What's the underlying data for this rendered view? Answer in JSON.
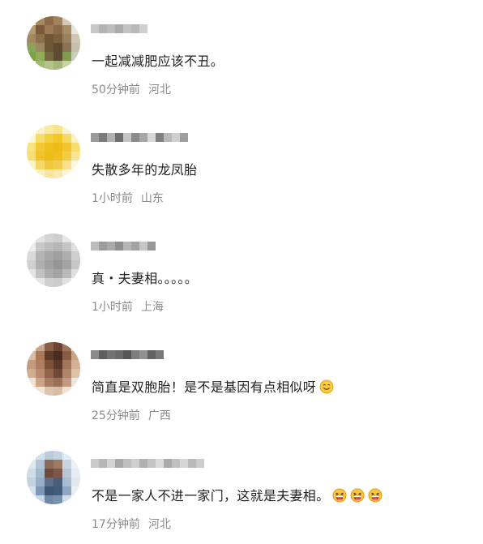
{
  "comments": [
    {
      "text": "一起减减肥应该不丑。",
      "time": "50分钟前",
      "location": "河北",
      "emoji_icon": "",
      "emoji_count": 0,
      "avatar_colors": [
        "#eef0ec",
        "#a4885e",
        "#8d6a45",
        "#a0825c",
        "#d6c9b1",
        "#f3f3f1",
        "#b69a72",
        "#7a5a3a",
        "#9b7b55",
        "#8a6a46",
        "#a78b66",
        "#e9e5dc",
        "#a0885f",
        "#8e6f4d",
        "#6f5436",
        "#7c5f3d",
        "#9a805c",
        "#d2c7b2",
        "#8aa35a",
        "#9a8a5d",
        "#6b5638",
        "#5e4a31",
        "#8a7352",
        "#c6bea9",
        "#7ea346",
        "#93ad58",
        "#76683f",
        "#5c4c32",
        "#819a4e",
        "#c9cfb8",
        "#e8ece1",
        "#9fbb6d",
        "#b2c487",
        "#a4b77a",
        "#c5d2a6",
        "#f1f3ec"
      ],
      "username_colors": [
        "#c7c7c7",
        "#b3b3b3",
        "#bdbdbd",
        "#aaaaaa",
        "#c2c2c2",
        "#b8b8b8",
        "#d0d0d0"
      ]
    },
    {
      "text": "失散多年的龙凤胎",
      "time": "1小时前",
      "location": "山东",
      "emoji_icon": "",
      "emoji_count": 0,
      "avatar_colors": [
        "#ffffff",
        "#fbf3c7",
        "#f9eaa0",
        "#f7e48a",
        "#fcf4cf",
        "#ffffff",
        "#fdf7dd",
        "#f6dd6b",
        "#f2cf3c",
        "#f1c72a",
        "#f5d964",
        "#fbf1c0",
        "#f7e27d",
        "#f1c733",
        "#efbf1c",
        "#eebc16",
        "#f1c430",
        "#f6dc6d",
        "#f6dd74",
        "#f0c22a",
        "#eebd1b",
        "#efbf22",
        "#f3cc45",
        "#f9e59a",
        "#fcf2c7",
        "#f5d86a",
        "#f1c741",
        "#f3cd52",
        "#f8e08d",
        "#fdf6dc",
        "#ffffff",
        "#fcf0c4",
        "#f9e5a3",
        "#fae9b0",
        "#fdf6dc",
        "#ffffff"
      ],
      "username_colors": [
        "#9a9a9a",
        "#7a7a7a",
        "#b0b0b0",
        "#6e6e6e",
        "#c4c4c4",
        "#8a8a8a",
        "#a6a6a6",
        "#d8d8d8",
        "#7f7f7f",
        "#b8b8b8",
        "#cfcfcf",
        "#9e9e9e"
      ]
    },
    {
      "text": "真・夫妻相。。。。。",
      "time": "1小时前",
      "location": "上海",
      "emoji_icon": "",
      "emoji_count": 0,
      "avatar_colors": [
        "#ffffff",
        "#e3e3e3",
        "#d4d4d4",
        "#cfcfcf",
        "#e6e6e6",
        "#ffffff",
        "#ececec",
        "#c8c8c8",
        "#bdbdbd",
        "#b5b5b5",
        "#c4c4c4",
        "#e0e0e0",
        "#d9d9d9",
        "#b3b3b3",
        "#a7a7a7",
        "#9e9e9e",
        "#adadad",
        "#cdcdcd",
        "#d0d0d0",
        "#b0b0b0",
        "#a1a1a1",
        "#959595",
        "#a4a4a4",
        "#c6c6c6",
        "#e4e4e4",
        "#c1c1c1",
        "#acacac",
        "#a3a3a3",
        "#b9b9b9",
        "#dedede",
        "#ffffff",
        "#e6e6e6",
        "#cfcfcf",
        "#cbcbcb",
        "#e0e0e0",
        "#ffffff"
      ],
      "username_colors": [
        "#bdbdbd",
        "#9c9c9c",
        "#aaaaaa",
        "#8f8f8f",
        "#b4b4b4",
        "#a3a3a3",
        "#c6c6c6",
        "#989898"
      ]
    },
    {
      "text": "简直是双胞胎！是不是基因有点相似呀",
      "time": "25分钟前",
      "location": "广西",
      "emoji_icon": "smile-emoji-icon",
      "emoji_count": 1,
      "avatar_colors": [
        "#f4ece4",
        "#c7a48a",
        "#8a5f45",
        "#6a4432",
        "#9f7559",
        "#e8dbcf",
        "#d9bea6",
        "#a9795a",
        "#5e3b2a",
        "#4a2c1f",
        "#8a5c42",
        "#c9a488",
        "#c59a7c",
        "#b07d5e",
        "#7d5039",
        "#5a3726",
        "#a3735a",
        "#d3b096",
        "#d0ac90",
        "#b98a6b",
        "#8f644a",
        "#714836",
        "#b08467",
        "#deC2a8",
        "#efe2d7",
        "#caa588",
        "#a67d61",
        "#9a7057",
        "#c29b7f",
        "#f2e6dc",
        "#ffffff",
        "#f0e4d9",
        "#dcc3ae",
        "#d7bca6",
        "#eee1d6",
        "#ffffff"
      ],
      "username_colors": [
        "#8a8a8a",
        "#5f5f5f",
        "#737373",
        "#6a6a6a",
        "#555555",
        "#7d7d7d",
        "#919191",
        "#636363",
        "#787878"
      ]
    },
    {
      "text": "不是一家人不进一家门，这就是夫妻相。",
      "time": "17分钟前",
      "location": "河北",
      "emoji_icon": "laughing-emoji-icon",
      "emoji_count": 3,
      "avatar_colors": [
        "#f3f6f9",
        "#d6e0ea",
        "#bccbdb",
        "#c6d3e1",
        "#e4eaf1",
        "#fafbfd",
        "#dfe7ef",
        "#b3c4d6",
        "#8a6a58",
        "#9c7a66",
        "#c8d5e2",
        "#eef2f6",
        "#cfdbe6",
        "#a5b9cd",
        "#6e4d3e",
        "#7c5848",
        "#b5c6d7",
        "#e6ecf2",
        "#c3d2e0",
        "#98afc6",
        "#5d6f86",
        "#4a5e78",
        "#a9bdd1",
        "#dfe7ef",
        "#d8e2ec",
        "#7f98b3",
        "#3e5676",
        "#435b7b",
        "#8fa7c0",
        "#e8eef4",
        "#f6f8fb",
        "#c8d5e2",
        "#6f89a7",
        "#7891ad",
        "#d3dee9",
        "#fbfcfd"
      ],
      "username_colors": [
        "#c9c9c9",
        "#b6b6b6",
        "#d3d3d3",
        "#a8a8a8",
        "#bebebe",
        "#cfcfcf",
        "#b0b0b0",
        "#c4c4c4",
        "#dadada",
        "#a9a9a9",
        "#c0c0c0",
        "#d6d6d6",
        "#b9b9b9",
        "#cccccc"
      ]
    }
  ]
}
